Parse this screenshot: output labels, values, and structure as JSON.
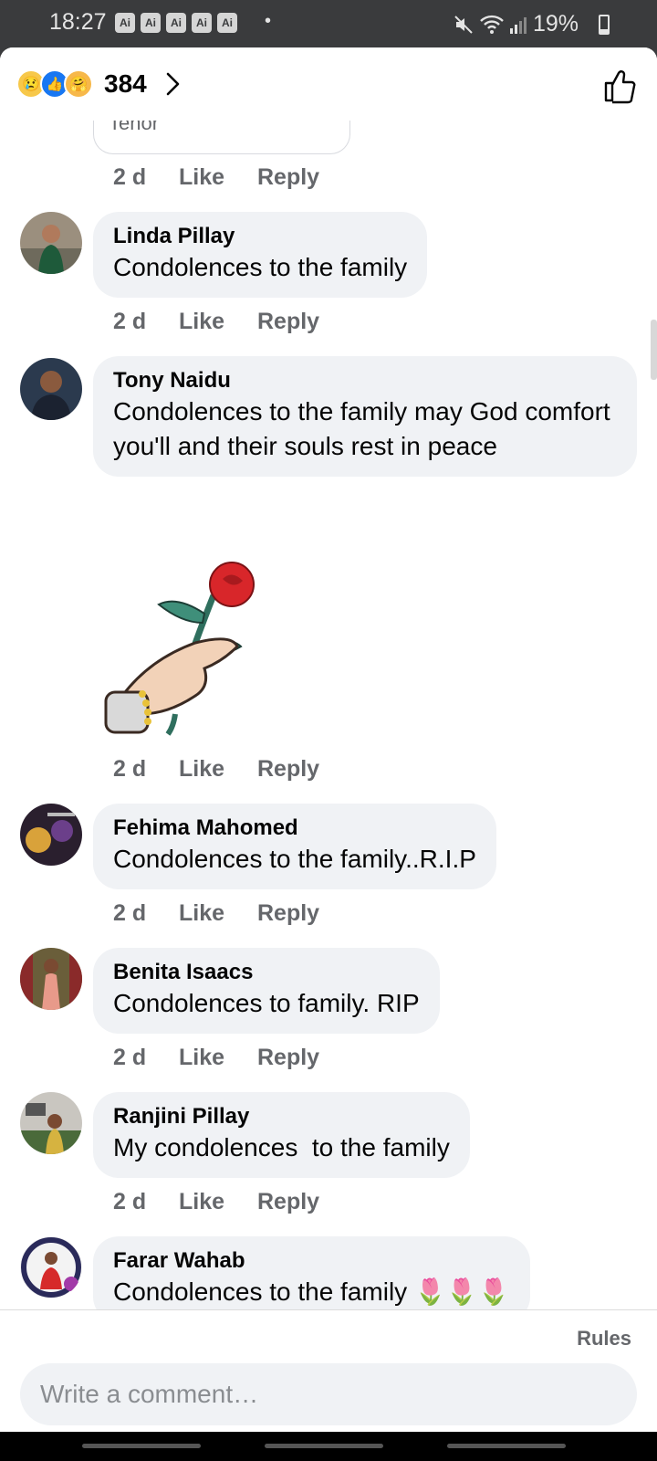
{
  "status_bar": {
    "time": "18:27",
    "ai_badges": [
      "Ai",
      "Ai",
      "Ai",
      "Ai",
      "Ai"
    ],
    "dot": "•",
    "battery": "19%"
  },
  "header": {
    "reactions": [
      "sad",
      "like",
      "care"
    ],
    "reaction_count": "384"
  },
  "previous_comment": {
    "attachment_label": "Tenor",
    "time": "2 d",
    "like": "Like",
    "reply": "Reply"
  },
  "comments": [
    {
      "author": "Linda Pillay",
      "text": "Condolences to the family",
      "time": "2 d",
      "like": "Like",
      "reply": "Reply"
    },
    {
      "author": "Tony Naidu",
      "text": "Condolences to the family may God comfort you'll and their souls rest in peace",
      "time": "2 d",
      "like": "Like",
      "reply": "Reply",
      "sticker": "hand-holding-rose"
    },
    {
      "author": "Fehima Mahomed",
      "text": "Condolences to the family..R.I.P",
      "time": "2 d",
      "like": "Like",
      "reply": "Reply"
    },
    {
      "author": "Benita Isaacs",
      "text": "Condolences to family. RIP",
      "time": "2 d",
      "like": "Like",
      "reply": "Reply"
    },
    {
      "author": "Ranjini Pillay",
      "text": "My condolences  to the family",
      "time": "2 d",
      "like": "Like",
      "reply": "Reply"
    },
    {
      "author": "Farar Wahab",
      "text": "Condolences to the family 🌷🌷🌷",
      "time": "",
      "like": "",
      "reply": ""
    }
  ],
  "composer": {
    "rules": "Rules",
    "placeholder": "Write a comment…"
  },
  "colors": {
    "bubble": "#f0f2f5",
    "meta_text": "#65676b",
    "like_blue": "#1877f2"
  }
}
